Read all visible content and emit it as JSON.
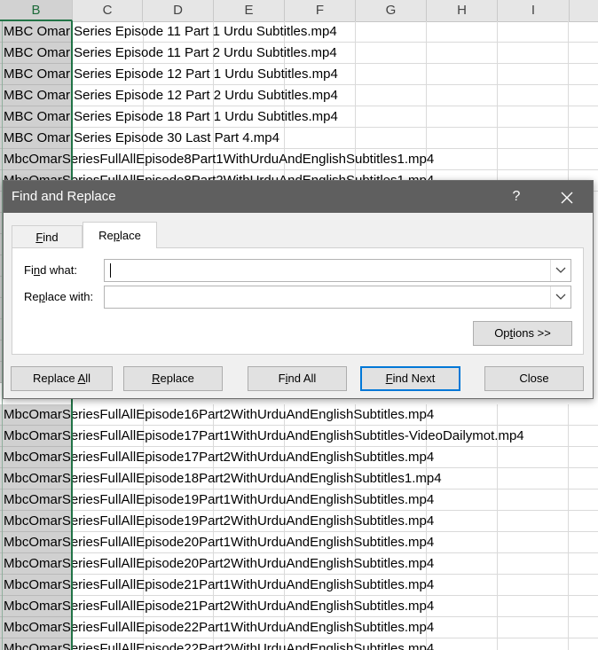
{
  "sheet": {
    "columns": [
      "B",
      "C",
      "D",
      "E",
      "F",
      "G",
      "H",
      "I"
    ],
    "selected_column": "B",
    "rows_top": [
      "MBC Omar Series Episode 11 Part 1 Urdu Subtitles.mp4",
      "MBC Omar Series Episode 11 Part 2 Urdu Subtitles.mp4",
      "MBC Omar Series Episode 12 Part 1 Urdu Subtitles.mp4",
      "MBC Omar Series Episode 12 Part 2 Urdu Subtitles.mp4",
      "MBC Omar Series Episode 18 Part 1 Urdu Subtitles.mp4",
      "MBC Omar Series Episode 30 Last Part 4.mp4",
      "MbcOmarSeriesFullAllEpisode8Part1WithUrduAndEnglishSubtitles1.mp4",
      "MbcOmarSeriesFullAllEpisode8Part2WithUrduAndEnglishSubtitles1.mp4"
    ],
    "rows_bottom": [
      "MbcOmarSeriesFullAllEpisode16Part2WithUrduAndEnglishSubtitles.mp4",
      "MbcOmarSeriesFullAllEpisode17Part1WithUrduAndEnglishSubtitles-VideoDailymot.mp4",
      "MbcOmarSeriesFullAllEpisode17Part2WithUrduAndEnglishSubtitles.mp4",
      "MbcOmarSeriesFullAllEpisode18Part2WithUrduAndEnglishSubtitles1.mp4",
      "MbcOmarSeriesFullAllEpisode19Part1WithUrduAndEnglishSubtitles.mp4",
      "MbcOmarSeriesFullAllEpisode19Part2WithUrduAndEnglishSubtitles.mp4",
      "MbcOmarSeriesFullAllEpisode20Part1WithUrduAndEnglishSubtitles.mp4",
      "MbcOmarSeriesFullAllEpisode20Part2WithUrduAndEnglishSubtitles.mp4",
      "MbcOmarSeriesFullAllEpisode21Part1WithUrduAndEnglishSubtitles.mp4",
      "MbcOmarSeriesFullAllEpisode21Part2WithUrduAndEnglishSubtitles.mp4",
      "MbcOmarSeriesFullAllEpisode22Part1WithUrduAndEnglishSubtitles.mp4",
      "MbcOmarSeriesFullAllEpisode22Part2WithUrduAndEnglishSubtitles.mp4"
    ]
  },
  "dialog": {
    "title": "Find and Replace",
    "help_label": "?",
    "close_icon": "close-icon",
    "tabs": {
      "find": {
        "pre": "",
        "key": "F",
        "post": "ind"
      },
      "replace": {
        "pre": "Re",
        "key": "p",
        "post": "lace"
      }
    },
    "find_what": {
      "pre": "Fi",
      "key": "n",
      "post": "d what:",
      "value": ""
    },
    "replace_with": {
      "pre": "Re",
      "key": "p",
      "post": "lace with:",
      "value": ""
    },
    "buttons": {
      "options": {
        "pre": "Op",
        "key": "t",
        "post": "ions >>"
      },
      "replace_all": {
        "pre": "Replace ",
        "key": "A",
        "post": "ll"
      },
      "replace": {
        "pre": "",
        "key": "R",
        "post": "eplace"
      },
      "find_all": {
        "pre": "F",
        "key": "i",
        "post": "nd All"
      },
      "find_next": {
        "pre": "",
        "key": "F",
        "post": "ind Next"
      },
      "close": "Close"
    }
  }
}
